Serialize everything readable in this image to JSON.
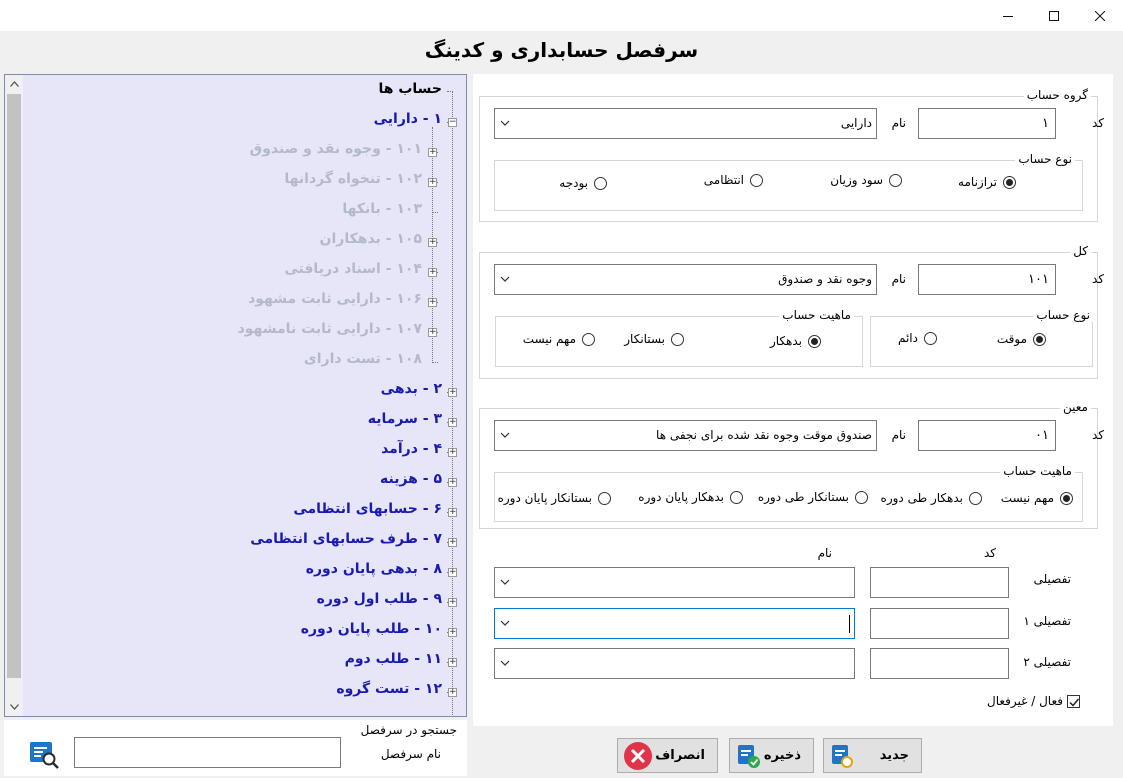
{
  "window": {
    "title": "سرفصل حسابداری و کدینگ",
    "controls": {
      "minimize": "minimize-icon",
      "maximize": "maximize-icon",
      "close": "close-icon"
    }
  },
  "tree": {
    "root": "حساب ها",
    "items": [
      {
        "label": "۱ - دارایی",
        "level": "top",
        "expanded": true
      },
      {
        "label": "۱۰۱ - وجوه نقد و صندوق",
        "level": "sub"
      },
      {
        "label": "۱۰۲ - تنخواه گردانها",
        "level": "sub"
      },
      {
        "label": "۱۰۳ - بانکها",
        "level": "sub"
      },
      {
        "label": "۱۰۵ - بدهکاران",
        "level": "sub"
      },
      {
        "label": "۱۰۴ - اسناد دریافتی",
        "level": "sub"
      },
      {
        "label": "۱۰۶ - دارایی ثابت مشهود",
        "level": "sub"
      },
      {
        "label": "۱۰۷ - دارایی ثابت نامشهود",
        "level": "sub"
      },
      {
        "label": "۱۰۸ - تست دارای",
        "level": "sub"
      },
      {
        "label": "۲ - بدهی",
        "level": "top"
      },
      {
        "label": "۳ - سرمایه",
        "level": "top"
      },
      {
        "label": "۴ - درآمد",
        "level": "top"
      },
      {
        "label": "۵ - هزینه",
        "level": "top"
      },
      {
        "label": "۶ - حسابهای انتظامی",
        "level": "top"
      },
      {
        "label": "۷ - طرف حسابهای انتظامی",
        "level": "top"
      },
      {
        "label": "۸ - بدهی پایان دوره",
        "level": "top"
      },
      {
        "label": "۹ - طلب اول دوره",
        "level": "top"
      },
      {
        "label": "۱۰ - طلب پایان دوره",
        "level": "top"
      },
      {
        "label": "۱۱ - طلب دوم",
        "level": "top"
      },
      {
        "label": "۱۲ - تست گروه",
        "level": "top"
      }
    ]
  },
  "search": {
    "title": "جستجو در سرفصل",
    "field_label": "نام سرفصل",
    "value": "",
    "icon": "search-list-icon"
  },
  "group_account": {
    "title": "گروه حساب",
    "code_label": "کد",
    "code_value": "۱",
    "name_label": "نام",
    "name_value": "دارایی",
    "type": {
      "title": "نوع حساب",
      "options": [
        "ترازنامه",
        "سود وزیان",
        "انتظامی",
        "بودجه"
      ],
      "selected": "ترازنامه"
    }
  },
  "general": {
    "title": "کل",
    "code_label": "کد",
    "code_value": "۱۰۱",
    "name_label": "نام",
    "name_value": "وجوه نقد و صندوق",
    "type": {
      "title": "نوع حساب",
      "options": [
        "موقت",
        "دائم"
      ],
      "selected": "موقت"
    },
    "nature": {
      "title": "ماهیت حساب",
      "options": [
        "بدهکار",
        "بستانکار",
        "مهم نیست"
      ],
      "selected": "بدهکار"
    }
  },
  "specific": {
    "title": "معین",
    "code_label": "کد",
    "code_value": "۰۱",
    "name_label": "نام",
    "name_value": "صندوق موقت وجوه نقد شده برای نجفی ها",
    "nature": {
      "title": "ماهیت حساب",
      "options": [
        "مهم نیست",
        "بدهکار طی دوره",
        "بستانکار طی دوره",
        "بدهکار پایان دوره",
        "بستانکار پایان دوره"
      ],
      "selected": "مهم نیست"
    }
  },
  "details": {
    "col_code": "کد",
    "col_name": "نام",
    "rows": [
      {
        "label": "تفصیلی",
        "code": "",
        "name": ""
      },
      {
        "label": "تفصیلی ۱",
        "code": "",
        "name": ""
      },
      {
        "label": "تفصیلی ۲",
        "code": "",
        "name": ""
      }
    ],
    "active_label": "فعال / غیرفعال",
    "active": true
  },
  "buttons": {
    "new": "جدید",
    "save": "ذخیره",
    "cancel": "انصراف"
  },
  "colors": {
    "tree_bg": "#e6e6f8",
    "top_item": "#1a1ab0",
    "sub_item": "#b4b9c8",
    "cancel_red": "#e0344a",
    "focus_blue": "#0078d7"
  }
}
